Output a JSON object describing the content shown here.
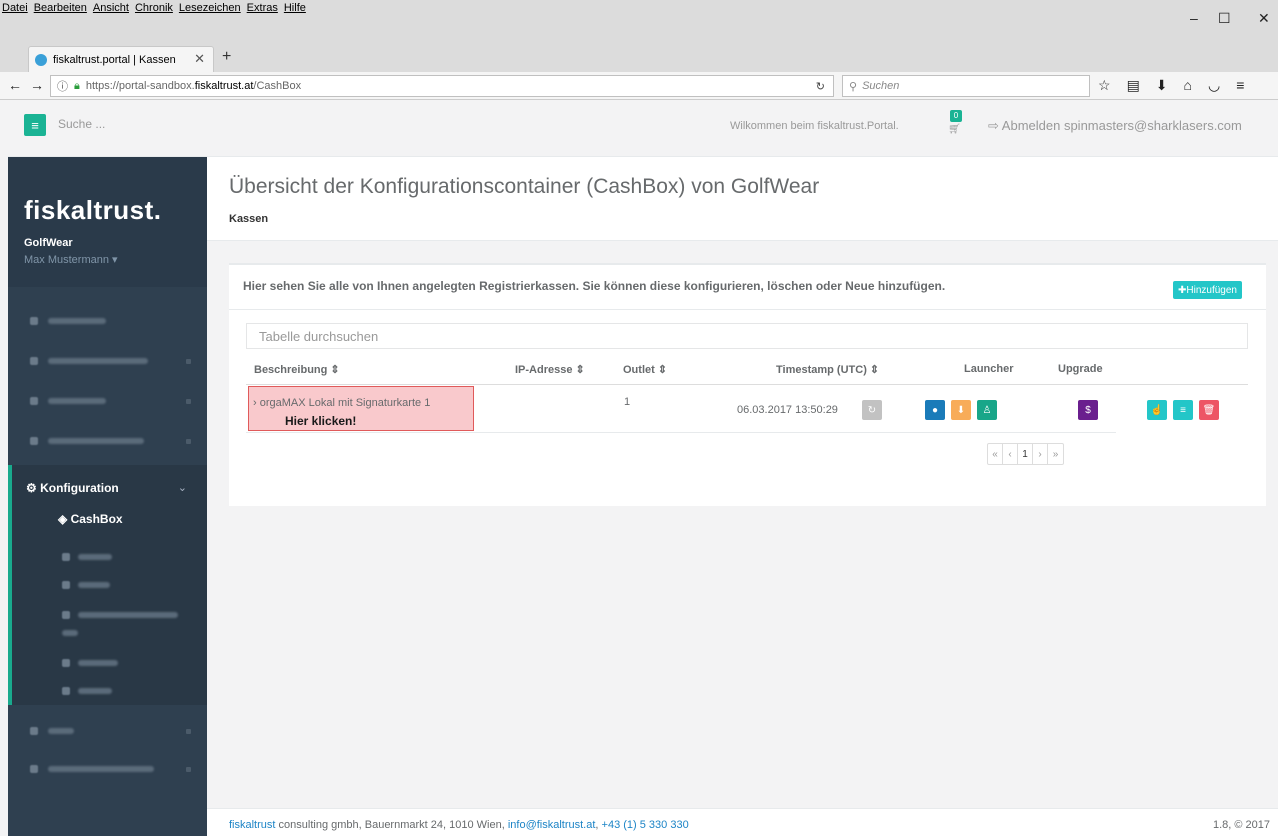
{
  "browser": {
    "menu": [
      "Datei",
      "Bearbeiten",
      "Ansicht",
      "Chronik",
      "Lesezeichen",
      "Extras",
      "Hilfe"
    ],
    "tab_title": "fiskaltrust.portal | Kassen",
    "url_prefix": "https://portal-sandbox.",
    "url_host": "fiskaltrust.at",
    "url_path": "/CashBox",
    "search_placeholder": "Suchen"
  },
  "topbar": {
    "search_placeholder": "Suche ...",
    "welcome": "Wilkommen beim fiskaltrust.Portal.",
    "cart_count": "0",
    "logout": "Abmelden spinmasters@sharklasers.com"
  },
  "sidebar": {
    "brand": "fiskaltrust.",
    "company": "GolfWear",
    "user": "Max Mustermann ▾",
    "active_group": "Konfiguration",
    "active_item": "CashBox"
  },
  "page": {
    "title": "Übersicht der Konfigurationscontainer (CashBox) von GolfWear",
    "breadcrumb": "Kassen"
  },
  "panel": {
    "intro": "Hier sehen Sie alle von Ihnen angelegten Registrierkassen. Sie können diese konfigurieren, löschen oder Neue hinzufügen.",
    "add_label": "Hinzufügen",
    "table_search_placeholder": "Tabelle durchsuchen",
    "columns": [
      "Beschreibung ⇕",
      "IP-Adresse ⇕",
      "Outlet ⇕",
      "Timestamp (UTC) ⇕",
      "Launcher",
      "Upgrade"
    ],
    "row": {
      "description": "orgaMAX Lokal mit Signaturkarte 1",
      "outlet": "1",
      "timestamp": "06.03.2017 13:50:29"
    },
    "hint": "Hier klicken!",
    "pager": [
      "«",
      "‹",
      "1",
      "›",
      "»"
    ]
  },
  "footer": {
    "company": "fiskaltrust",
    "address": " consulting gmbh, Bauernmarkt 24, 1010 Wien, ",
    "email": "info@fiskaltrust.at",
    "phone": "+43 (1) 5 330 330",
    "version": "1.8, © 2017"
  }
}
